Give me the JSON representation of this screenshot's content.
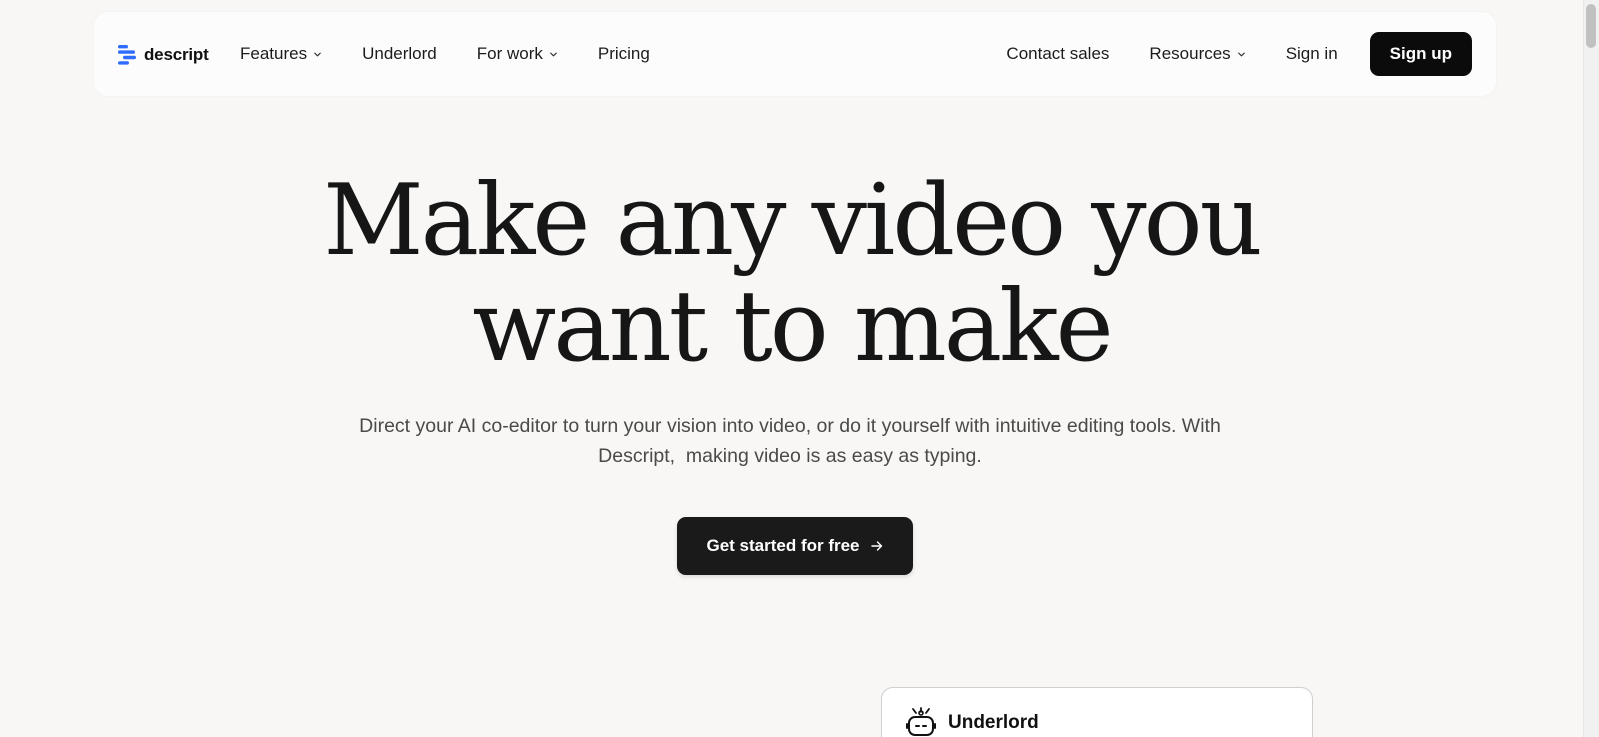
{
  "brand": {
    "name": "descript",
    "accent_color": "#2f6bff"
  },
  "nav": {
    "left_items": [
      {
        "label": "Features",
        "has_dropdown": true
      },
      {
        "label": "Underlord",
        "has_dropdown": false
      },
      {
        "label": "For work",
        "has_dropdown": true
      },
      {
        "label": "Pricing",
        "has_dropdown": false
      }
    ],
    "contact_sales": "Contact sales",
    "resources": "Resources",
    "sign_in": "Sign in",
    "sign_up": "Sign up"
  },
  "hero": {
    "title_line1": "Make any video you",
    "title_line2": "want to make",
    "subtitle_line1": "Direct your AI co-editor to turn your vision into video, or do it yourself with intuitive editing tools. With",
    "subtitle_line2": "Descript,  making video is as easy as typing.",
    "cta_label": "Get started for free"
  },
  "underlord_card": {
    "title": "Underlord",
    "icon": "robot-icon"
  }
}
